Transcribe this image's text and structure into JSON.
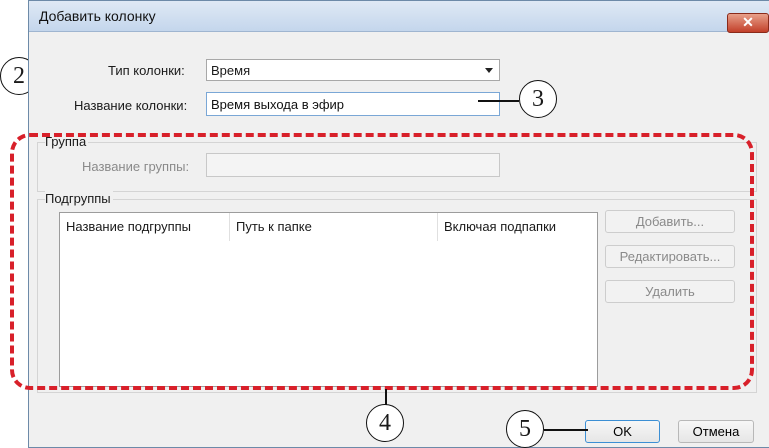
{
  "window": {
    "title": "Добавить колонку",
    "close_symbol": "✕"
  },
  "form": {
    "column_type_label": "Тип колонки:",
    "column_type_value": "Время",
    "column_name_label": "Название колонки:",
    "column_name_value": "Время выхода в эфир"
  },
  "group": {
    "legend": "Группа",
    "group_name_label": "Название группы:",
    "group_name_value": ""
  },
  "subgroups": {
    "legend": "Подгруппы",
    "columns": [
      "Название подгруппы",
      "Путь к папке",
      "Включая подпапки"
    ],
    "rows": [],
    "buttons": {
      "add": "Добавить...",
      "edit": "Редактировать...",
      "delete": "Удалить"
    }
  },
  "footer": {
    "ok": "OK",
    "cancel": "Отмена"
  },
  "callouts": [
    "2",
    "3",
    "4",
    "5"
  ],
  "colors": {
    "highlight_dash": "#d8202a",
    "close_button": "#c2402a"
  }
}
